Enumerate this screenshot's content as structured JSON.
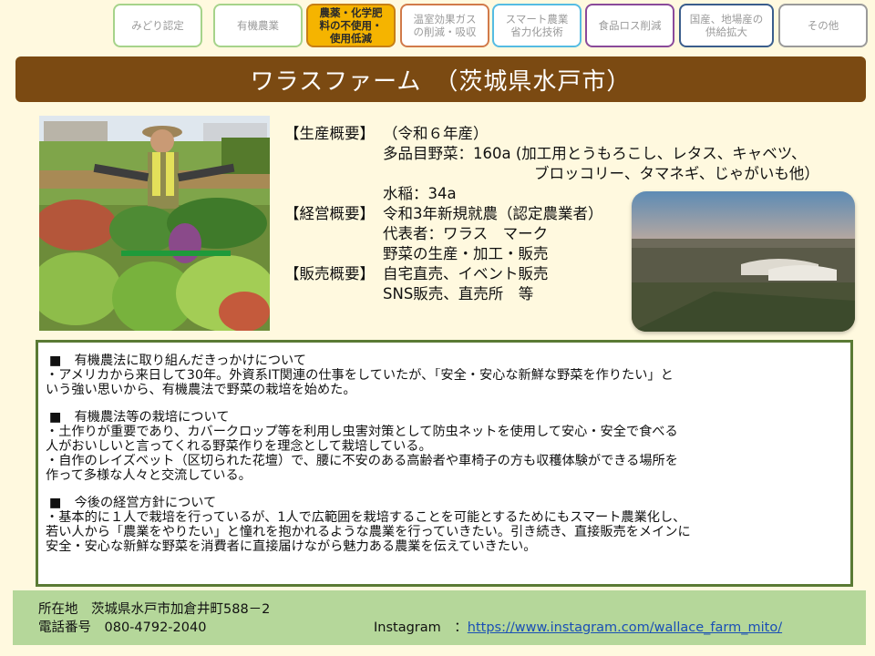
{
  "tabs": [
    {
      "label": "みどり認定",
      "color": "#a6d38a",
      "active": false
    },
    {
      "label": "有機農業",
      "color": "#a6d38a",
      "active": false
    },
    {
      "label": "農薬・化学肥\n料の不使用・\n使用低減",
      "color": "#c77f14",
      "active": true
    },
    {
      "label": "温室効果ガス\nの削減・吸収",
      "color": "#d17a4a",
      "active": false
    },
    {
      "label": "スマート農業\n省力化技術",
      "color": "#55bce3",
      "active": false
    },
    {
      "label": "食品ロス削減",
      "color": "#8a4a9a",
      "active": false
    },
    {
      "label": "国産、地場産の\n供給拡大",
      "color": "#3a5d8c",
      "active": false
    },
    {
      "label": "その他",
      "color": "#9a9a9a",
      "active": false
    }
  ],
  "title": "ワラスファーム　（茨城県水戸市）",
  "overview": {
    "production_label": "【生産概要】",
    "production_year": "（令和６年産）",
    "vegetables_line1": "多品目野菜：160a (加工用とうもろこし、レタス、キャベツ、",
    "vegetables_line2": "ブロッコリー、タマネギ、じゃがいも他）",
    "rice": "水稲：34a",
    "management_label": "【経営概要】",
    "management_1": "令和3年新規就農（認定農業者）",
    "management_2": "代表者：ワラス　マーク",
    "management_3": "野菜の生産・加工・販売",
    "sales_label": "【販売概要】",
    "sales_1": "自宅直売、イベント販売",
    "sales_2": "SNS販売、直売所　等"
  },
  "story": {
    "s1_head": "■　有機農法に取り組んだきっかけについて",
    "s1_l1": "・アメリカから来日して30年。外資系IT関連の仕事をしていたが、「安全・安心な新鮮な野菜を作りたい」と",
    "s1_l2": "いう強い思いから、有機農法で野菜の栽培を始めた。",
    "s2_head": "■　有機農法等の栽培について",
    "s2_l1": "・土作りが重要であり、カバークロップ等を利用し虫害対策として防虫ネットを使用して安心・安全で食べる",
    "s2_l2": "人がおいしいと言ってくれる野菜作りを理念として栽培している。",
    "s2_l3": "・自作のレイズベット（区切られた花壇）で、腰に不安のある高齢者や車椅子の方も収穫体験ができる場所を",
    "s2_l4": "作って多様な人々と交流している。",
    "s3_head": "■　今後の経営方針について",
    "s3_l1": "・基本的に１人で栽培を行っているが、1人で広範囲を栽培することを可能とするためにもスマート農業化し、",
    "s3_l2": "若い人から「農業をやりたい」と憧れを抱かれるような農業を行っていきたい。引き続き、直接販売をメインに",
    "s3_l3": "安全・安心な新鮮な野菜を消費者に直接届けながら魅力ある農業を伝えていきたい。"
  },
  "footer": {
    "address": "所在地　茨城県水戸市加倉井町588－2",
    "phone": "電話番号　080-4792-2040",
    "instagram_label": "Instagram　：",
    "instagram_url": "https://www.instagram.com/wallace_farm_mito/"
  }
}
